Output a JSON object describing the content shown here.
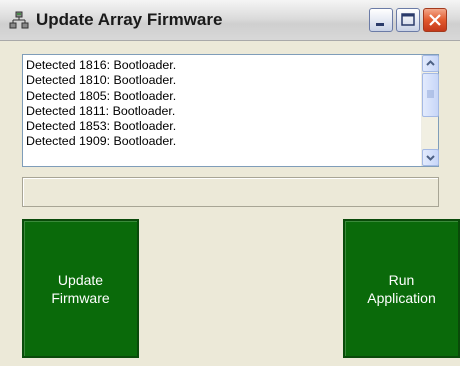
{
  "window": {
    "title": "Update Array Firmware",
    "icon": "array-network-icon"
  },
  "title_bar_buttons": [
    {
      "name": "minimize",
      "icon": "minimize-icon"
    },
    {
      "name": "maximize",
      "icon": "maximize-icon"
    },
    {
      "name": "close",
      "icon": "close-icon"
    }
  ],
  "log": {
    "lines": [
      "Detected 1816: Bootloader.",
      "Detected 1810: Bootloader.",
      "Detected 1805: Bootloader.",
      "Detected 1811: Bootloader.",
      "Detected 1853: Bootloader.",
      "Detected 1909: Bootloader."
    ]
  },
  "status": {
    "text": ""
  },
  "buttons": {
    "update_firmware": "Update\nFirmware",
    "run_application": "Run\nApplication"
  },
  "colors": {
    "button_green": "#0a6a0a",
    "window_bg": "#ece9d8",
    "close_red": "#e25a2e"
  }
}
